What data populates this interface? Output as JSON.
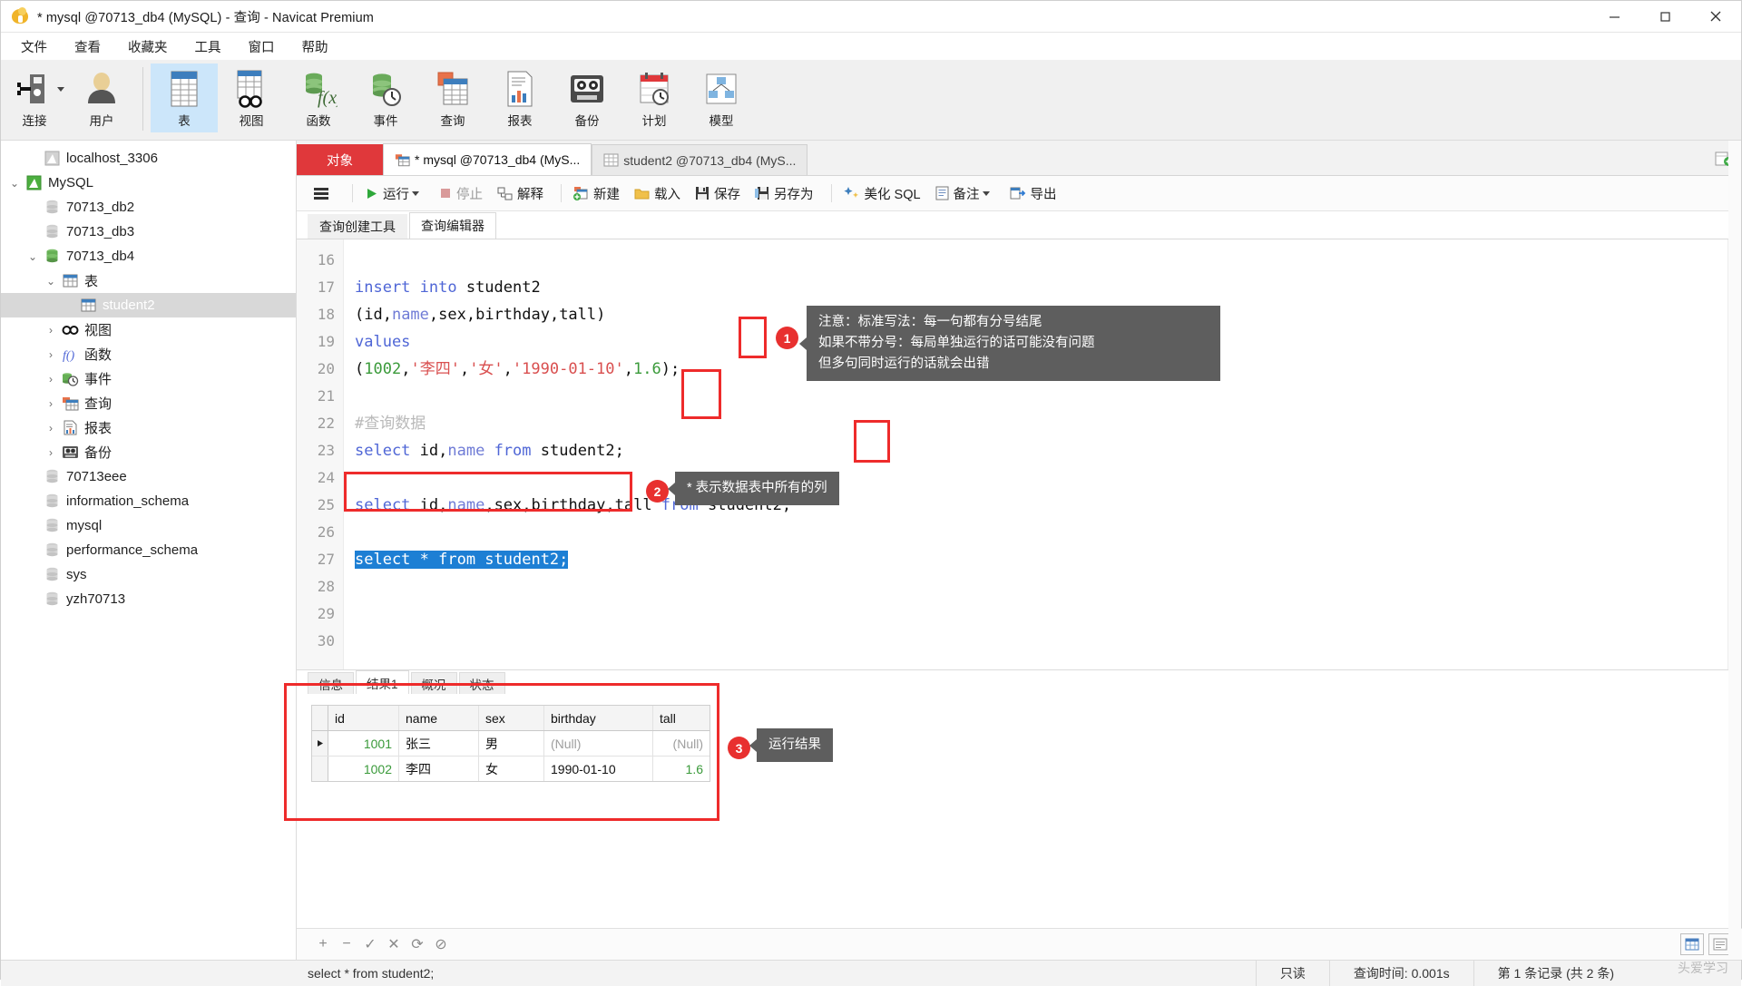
{
  "window": {
    "title": "* mysql @70713_db4 (MySQL) - 查询 - Navicat Premium",
    "minimize": "—",
    "maximize": "▢",
    "close": "✕"
  },
  "menubar": {
    "items": [
      {
        "label": "文件"
      },
      {
        "label": "查看"
      },
      {
        "label": "收藏夹"
      },
      {
        "label": "工具"
      },
      {
        "label": "窗口"
      },
      {
        "label": "帮助"
      }
    ]
  },
  "ribbon": {
    "items": [
      {
        "label": "连接",
        "icon": "connection-icon",
        "has_caret": true
      },
      {
        "label": "用户",
        "icon": "user-icon",
        "has_caret": false
      },
      {
        "label": "表",
        "icon": "table-icon",
        "active": true
      },
      {
        "label": "视图",
        "icon": "view-icon"
      },
      {
        "label": "函数",
        "icon": "function-icon"
      },
      {
        "label": "事件",
        "icon": "event-icon"
      },
      {
        "label": "查询",
        "icon": "query-icon"
      },
      {
        "label": "报表",
        "icon": "report-icon"
      },
      {
        "label": "备份",
        "icon": "backup-icon"
      },
      {
        "label": "计划",
        "icon": "schedule-icon"
      },
      {
        "label": "模型",
        "icon": "model-icon"
      }
    ]
  },
  "sidebar": {
    "items": [
      {
        "label": "localhost_3306",
        "icon": "connection-gray-icon",
        "indent": 1,
        "chev": "",
        "selected": false
      },
      {
        "label": "MySQL",
        "icon": "connection-green-icon",
        "indent": 0,
        "chev": "v",
        "selected": false
      },
      {
        "label": "70713_db2",
        "icon": "db-gray-icon",
        "indent": 2,
        "chev": "",
        "selected": false
      },
      {
        "label": "70713_db3",
        "icon": "db-gray-icon",
        "indent": 2,
        "chev": "",
        "selected": false
      },
      {
        "label": "70713_db4",
        "icon": "db-green-icon",
        "indent": 1,
        "chev": "v",
        "selected": false
      },
      {
        "label": "表",
        "icon": "table-icon",
        "indent": 2,
        "chev": "v",
        "selected": false
      },
      {
        "label": "student2",
        "icon": "table-icon",
        "indent": 4,
        "chev": "",
        "selected": true
      },
      {
        "label": "视图",
        "icon": "view-icon",
        "indent": 2,
        "chev": ">",
        "selected": false
      },
      {
        "label": "函数",
        "icon": "function-icon",
        "indent": 2,
        "chev": ">",
        "selected": false
      },
      {
        "label": "事件",
        "icon": "event-icon",
        "indent": 2,
        "chev": ">",
        "selected": false
      },
      {
        "label": "查询",
        "icon": "query-icon",
        "indent": 2,
        "chev": ">",
        "selected": false
      },
      {
        "label": "报表",
        "icon": "report-icon",
        "indent": 2,
        "chev": ">",
        "selected": false
      },
      {
        "label": "备份",
        "icon": "backup-icon",
        "indent": 2,
        "chev": ">",
        "selected": false
      },
      {
        "label": "70713eee",
        "icon": "db-gray-icon",
        "indent": 2,
        "chev": "",
        "selected": false
      },
      {
        "label": "information_schema",
        "icon": "db-gray-icon",
        "indent": 2,
        "chev": "",
        "selected": false
      },
      {
        "label": "mysql",
        "icon": "db-gray-icon",
        "indent": 2,
        "chev": "",
        "selected": false
      },
      {
        "label": "performance_schema",
        "icon": "db-gray-icon",
        "indent": 2,
        "chev": "",
        "selected": false
      },
      {
        "label": "sys",
        "icon": "db-gray-icon",
        "indent": 2,
        "chev": "",
        "selected": false
      },
      {
        "label": "yzh70713",
        "icon": "db-gray-icon",
        "indent": 2,
        "chev": "",
        "selected": false
      }
    ]
  },
  "doctabs": {
    "object_button": "对象",
    "tabs": [
      {
        "label": "* mysql @70713_db4 (MyS...",
        "icon": "query-icon",
        "active": true
      },
      {
        "label": "student2 @70713_db4 (MyS...",
        "icon": "table-icon",
        "active": false
      }
    ],
    "add_tab": "+"
  },
  "query_toolbar": {
    "menu_icon": "hamburger-icon",
    "buttons": [
      {
        "label": "运行",
        "icon": "run-icon",
        "caret": true,
        "dim": false
      },
      {
        "label": "停止",
        "icon": "stop-icon",
        "caret": false,
        "dim": true
      },
      {
        "label": "解释",
        "icon": "explain-icon",
        "caret": false,
        "dim": false
      },
      {
        "label": "新建",
        "icon": "new-icon",
        "caret": false,
        "dim": false
      },
      {
        "label": "载入",
        "icon": "load-icon",
        "caret": false,
        "dim": false
      },
      {
        "label": "保存",
        "icon": "save-icon",
        "caret": false,
        "dim": false
      },
      {
        "label": "另存为",
        "icon": "save-as-icon",
        "caret": false,
        "dim": false
      },
      {
        "label": "美化 SQL",
        "icon": "beautify-icon",
        "caret": false,
        "dim": false
      },
      {
        "label": "备注",
        "icon": "comment-icon",
        "caret": true,
        "dim": false
      },
      {
        "label": "导出",
        "icon": "export-icon",
        "caret": false,
        "dim": false
      }
    ]
  },
  "editor_tabs": [
    {
      "label": "查询创建工具",
      "active": false
    },
    {
      "label": "查询编辑器",
      "active": true
    }
  ],
  "editor": {
    "first_line": 16,
    "lines": [
      {
        "no": "16",
        "segments": []
      },
      {
        "no": "17",
        "segments": [
          {
            "t": "insert into ",
            "c": "kw"
          },
          {
            "t": "student2",
            "c": ""
          }
        ]
      },
      {
        "no": "18",
        "segments": [
          {
            "t": "(id,",
            "c": ""
          },
          {
            "t": "name",
            "c": "col"
          },
          {
            "t": ",sex,birthday,tall)",
            "c": ""
          }
        ]
      },
      {
        "no": "19",
        "segments": [
          {
            "t": "values",
            "c": "kw"
          }
        ]
      },
      {
        "no": "20",
        "segments": [
          {
            "t": "(",
            "c": ""
          },
          {
            "t": "1002",
            "c": "num"
          },
          {
            "t": ",",
            "c": ""
          },
          {
            "t": "'李四'",
            "c": "str"
          },
          {
            "t": ",",
            "c": ""
          },
          {
            "t": "'女'",
            "c": "str"
          },
          {
            "t": ",",
            "c": ""
          },
          {
            "t": "'1990-01-10'",
            "c": "str"
          },
          {
            "t": ",",
            "c": ""
          },
          {
            "t": "1.6",
            "c": "num"
          },
          {
            "t": ");",
            "c": ""
          }
        ]
      },
      {
        "no": "21",
        "segments": []
      },
      {
        "no": "22",
        "segments": [
          {
            "t": "#查询数据",
            "c": "cmt"
          }
        ]
      },
      {
        "no": "23",
        "segments": [
          {
            "t": "select ",
            "c": "kw"
          },
          {
            "t": "id,",
            "c": ""
          },
          {
            "t": "name",
            "c": "col"
          },
          {
            "t": " from ",
            "c": "kw"
          },
          {
            "t": "student2;",
            "c": ""
          }
        ]
      },
      {
        "no": "24",
        "segments": []
      },
      {
        "no": "25",
        "segments": [
          {
            "t": "select ",
            "c": "kw"
          },
          {
            "t": "id,",
            "c": ""
          },
          {
            "t": "name",
            "c": "col"
          },
          {
            "t": ",sex,birthday,tall ",
            "c": ""
          },
          {
            "t": "from ",
            "c": "kw"
          },
          {
            "t": "student2;",
            "c": ""
          }
        ]
      },
      {
        "no": "26",
        "segments": []
      },
      {
        "no": "27",
        "segments": [
          {
            "t": "select * from student2;",
            "c": "sel"
          }
        ]
      },
      {
        "no": "28",
        "segments": []
      },
      {
        "no": "29",
        "segments": []
      },
      {
        "no": "30",
        "segments": []
      }
    ]
  },
  "annotations": [
    {
      "number": "1",
      "text": "注意：标准写法：每一句都有分号结尾\n如果不带分号：每局单独运行的话可能没有问题\n但多句同时运行的话就会出错"
    },
    {
      "number": "2",
      "text": "* 表示数据表中所有的列"
    },
    {
      "number": "3",
      "text": "运行结果"
    }
  ],
  "result_tabs": [
    {
      "label": "信息",
      "active": false
    },
    {
      "label": "结果1",
      "active": true
    },
    {
      "label": "概况",
      "active": false
    },
    {
      "label": "状态",
      "active": false
    }
  ],
  "result_grid": {
    "columns": [
      "id",
      "name",
      "sex",
      "birthday",
      "tall"
    ],
    "rows": [
      {
        "current": true,
        "cells": [
          "1001",
          "张三",
          "男",
          "(Null)",
          "(Null)"
        ]
      },
      {
        "current": false,
        "cells": [
          "1002",
          "李四",
          "女",
          "1990-01-10",
          "1.6"
        ]
      }
    ]
  },
  "grid_toolbar": {
    "buttons": [
      "+",
      "−",
      "✓",
      "✕",
      "⟳",
      "⊘"
    ]
  },
  "statusbar": {
    "sql": "select * from student2;",
    "readonly": "只读",
    "query_time": "查询时间: 0.001s",
    "record_info": "第 1 条记录 (共 2 条)",
    "watermark": "头爱学习"
  },
  "colors": {
    "accent_red": "#e0383b",
    "annotation_red": "#ee2b2b",
    "selection_blue": "#1d7fd4",
    "ribbon_active": "#cce6fa"
  }
}
